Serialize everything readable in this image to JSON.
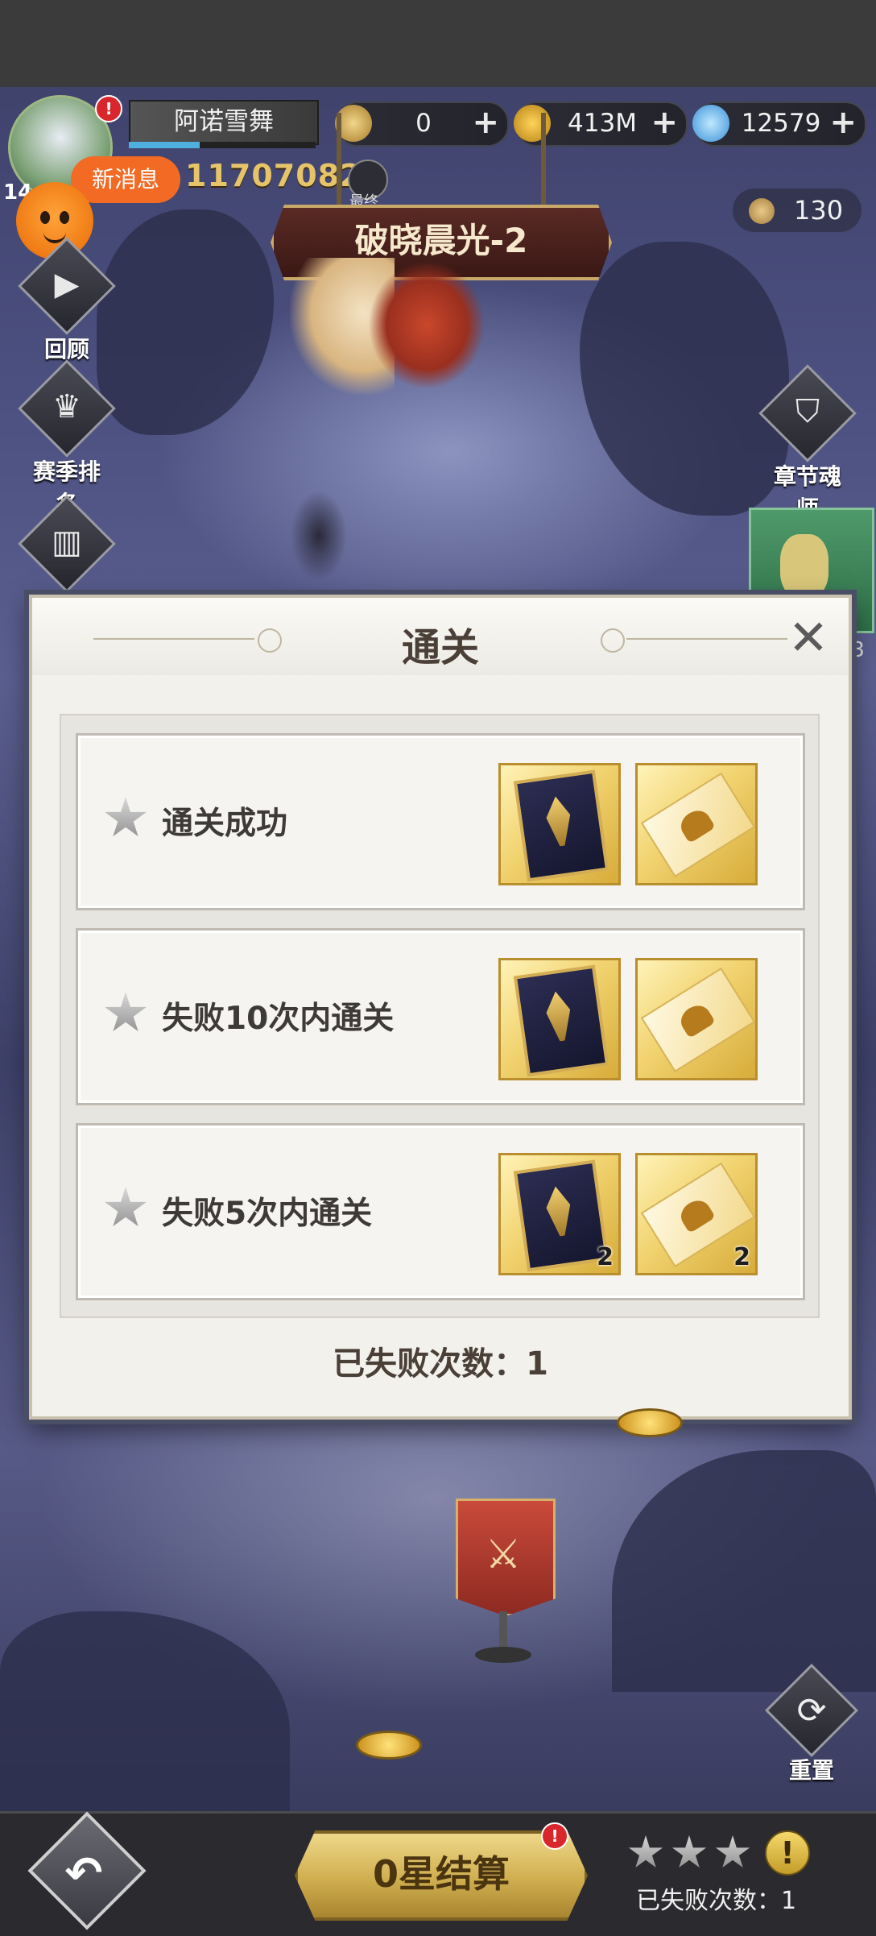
{
  "hud": {
    "player_name": "阿诺雪舞",
    "level": "14",
    "power": "117070821",
    "search_label": "最终",
    "new_message": "新消息",
    "alert_dot": "!"
  },
  "currencies": [
    {
      "name": "compass-coin",
      "value": "0",
      "color": "#c9a04a"
    },
    {
      "name": "gold",
      "value": "413M",
      "color": "#d9a42a"
    },
    {
      "name": "diamond",
      "value": "12579",
      "color": "#4fb3e8"
    }
  ],
  "soul_count": "130",
  "stage": {
    "title": "破晓晨光-2"
  },
  "side_menu": {
    "review": "回顾",
    "season_rank": "赛季排名",
    "codex": "神谕",
    "chapter_soul": "章节魂师",
    "side_number": "-3"
  },
  "modal": {
    "title": "通关",
    "close": "✕",
    "rows": [
      {
        "text": "通关成功",
        "rewards": [
          {
            "type": "card",
            "qty": ""
          },
          {
            "type": "ticket",
            "qty": ""
          }
        ]
      },
      {
        "text": "失败10次内通关",
        "rewards": [
          {
            "type": "card",
            "qty": ""
          },
          {
            "type": "ticket",
            "qty": ""
          }
        ]
      },
      {
        "text": "失败5次内通关",
        "rewards": [
          {
            "type": "card",
            "qty": "2"
          },
          {
            "type": "ticket",
            "qty": "2"
          }
        ]
      }
    ],
    "fail_count_text": "已失败次数：1"
  },
  "reset_label": "重置",
  "bottom": {
    "settle_label": "0星结算",
    "settle_alert": "!",
    "warn": "!",
    "fail_count_text": "已失败次数：1"
  }
}
